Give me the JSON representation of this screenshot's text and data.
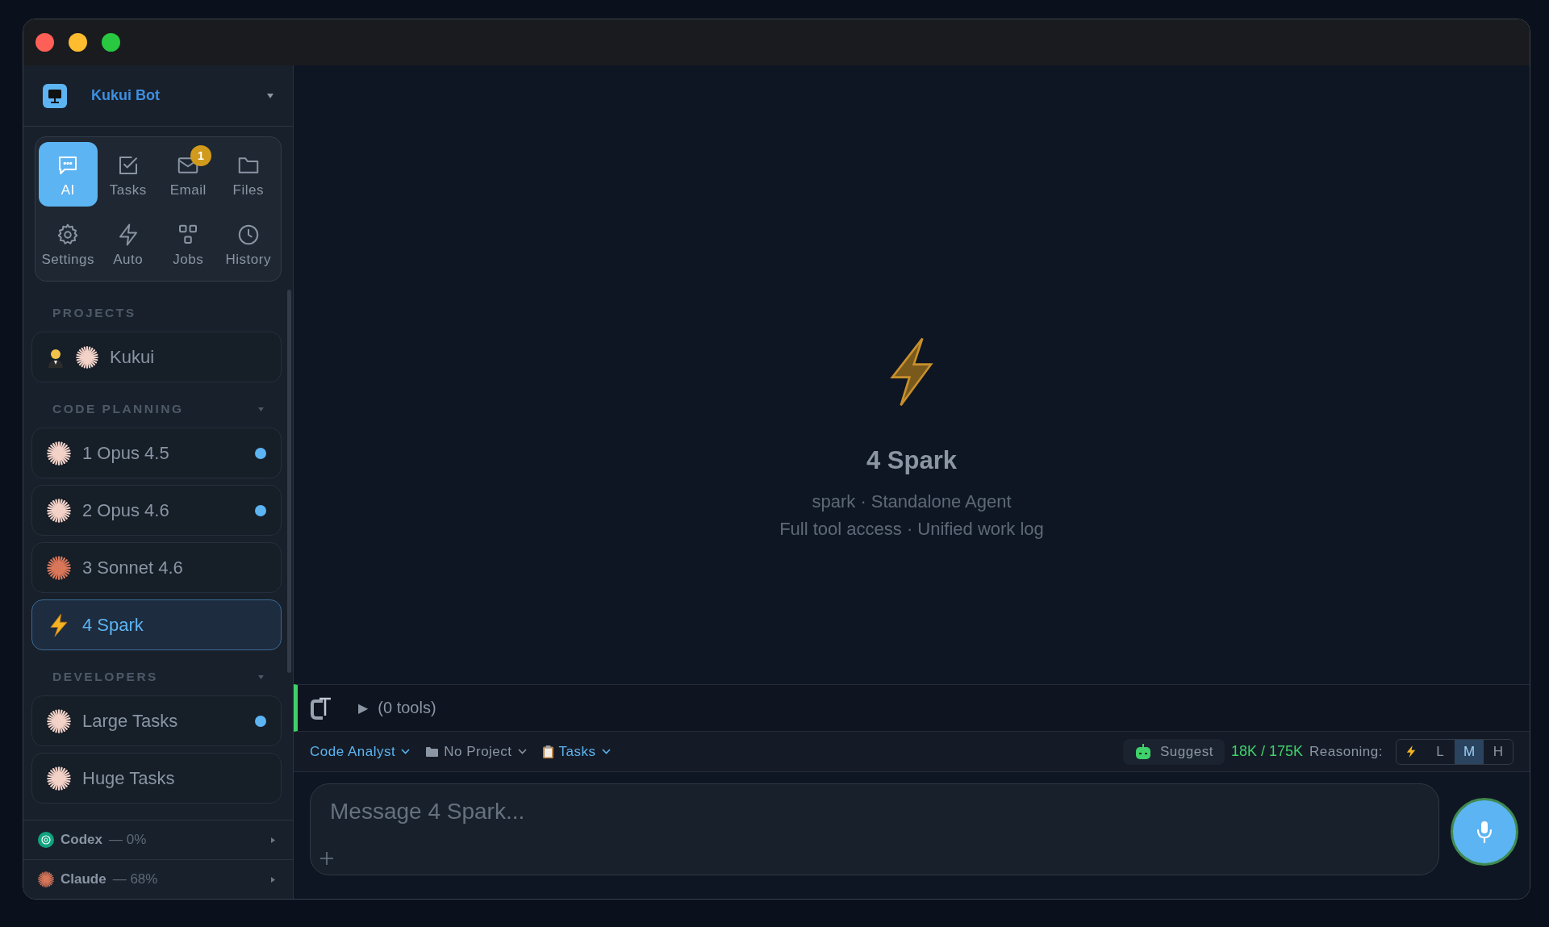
{
  "workspace": {
    "name": "Kukui Bot"
  },
  "nav": [
    {
      "label": "AI",
      "kind": "chat",
      "selected": true
    },
    {
      "label": "Tasks",
      "kind": "tasks",
      "selected": false
    },
    {
      "label": "Email",
      "kind": "mail",
      "selected": false,
      "badge": "1"
    },
    {
      "label": "Files",
      "kind": "folder",
      "selected": false
    },
    {
      "label": "Settings",
      "kind": "gear",
      "selected": false
    },
    {
      "label": "Auto",
      "kind": "bolt",
      "selected": false
    },
    {
      "label": "Jobs",
      "kind": "grid",
      "selected": false
    },
    {
      "label": "History",
      "kind": "clock",
      "selected": false
    }
  ],
  "sections": [
    {
      "title": "PROJECTS",
      "kind": "fixed",
      "items": [
        {
          "label": "Kukui",
          "kind": "project",
          "unread": false,
          "selected": false
        }
      ]
    },
    {
      "title": "CODE PLANNING",
      "kind": "collapsible",
      "items": [
        {
          "label": "1 Opus 4.5",
          "kind": "burst-light",
          "unread": true,
          "selected": false
        },
        {
          "label": "2 Opus 4.6",
          "kind": "burst-light",
          "unread": true,
          "selected": false
        },
        {
          "label": "3 Sonnet 4.6",
          "kind": "burst-orange",
          "unread": false,
          "selected": false
        },
        {
          "label": "4 Spark",
          "kind": "spark",
          "unread": false,
          "selected": true
        }
      ]
    },
    {
      "title": "DEVELOPERS",
      "kind": "collapsible",
      "items": [
        {
          "label": "Large Tasks",
          "kind": "burst-light",
          "unread": true,
          "selected": false
        },
        {
          "label": "Huge Tasks",
          "kind": "burst-light",
          "unread": false,
          "selected": false
        }
      ]
    }
  ],
  "usage": [
    {
      "name": "Codex",
      "reading": "— 0%",
      "kind": "codex"
    },
    {
      "name": "Claude",
      "reading": "— 68%",
      "kind": "claude"
    }
  ],
  "agent": {
    "name": "4 Spark",
    "subtitle": "spark · Standalone Agent",
    "caption": "Full tool access · Unified work log"
  },
  "tools": {
    "toggle": "▶",
    "label": "(0 tools)"
  },
  "toolbar": {
    "agent": "Code Analyst",
    "project": "No Project",
    "view": "Tasks",
    "suggest": "Suggest",
    "tokens": "18K / 175K",
    "reasoning_label": "Reasoning:",
    "reasoning": [
      {
        "kind": "icon",
        "selected": false
      },
      {
        "kind": "text",
        "label": "L",
        "selected": false
      },
      {
        "kind": "text",
        "label": "M",
        "selected": true
      },
      {
        "kind": "text",
        "label": "H",
        "selected": false
      }
    ]
  },
  "composer": {
    "placeholder": "Message 4 Spark..."
  }
}
